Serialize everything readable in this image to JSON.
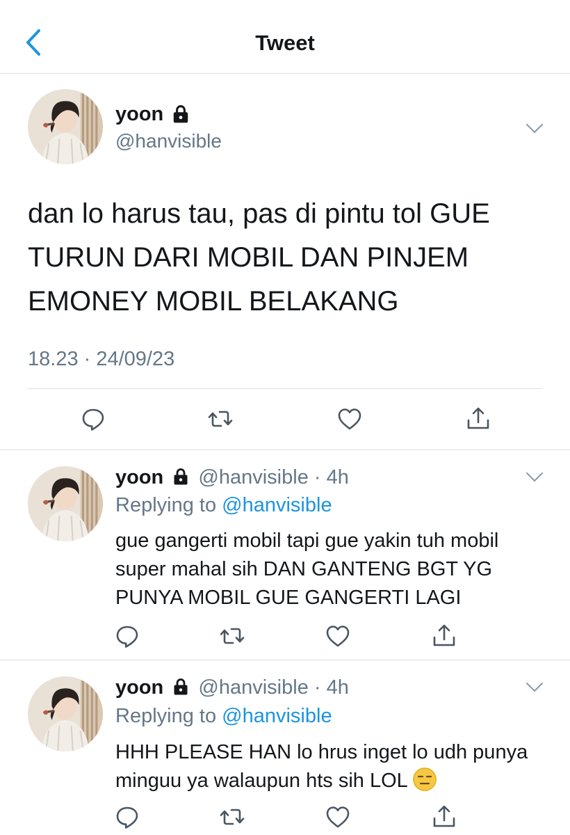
{
  "header": {
    "title": "Tweet"
  },
  "main_tweet": {
    "name": "yoon",
    "handle": "@hanvisible",
    "text": "dan lo harus tau, pas di pintu tol GUE TURUN DARI MOBIL DAN PINJEM EMONEY MOBIL BELAKANG",
    "timestamp": "18.23 · 24/09/23"
  },
  "replies": [
    {
      "name": "yoon",
      "handle": "@hanvisible",
      "time": "· 4h",
      "replying_prefix": "Replying to",
      "replying_to": "@hanvisible",
      "text": "gue gangerti mobil tapi gue yakin tuh mobil super mahal sih DAN GANTENG BGT YG PUNYA MOBIL GUE GANGERTI LAGI"
    },
    {
      "name": "yoon",
      "handle": "@hanvisible",
      "time": "· 4h",
      "replying_prefix": "Replying to",
      "replying_to": "@hanvisible",
      "text": "HHH PLEASE HAN lo hrus inget lo udh punya minguu ya walaupun hts sih LOL",
      "emoji": "expressionless-face"
    }
  ],
  "icons": {
    "back": "chevron-left-icon",
    "lock": "lock-icon",
    "more": "chevron-down-icon",
    "reply": "reply-icon",
    "retweet": "retweet-icon",
    "like": "heart-icon",
    "share": "share-icon"
  },
  "colors": {
    "accent": "#1c94e0",
    "muted": "#657786",
    "text": "#14171a",
    "divider": "#dcdfe2"
  }
}
